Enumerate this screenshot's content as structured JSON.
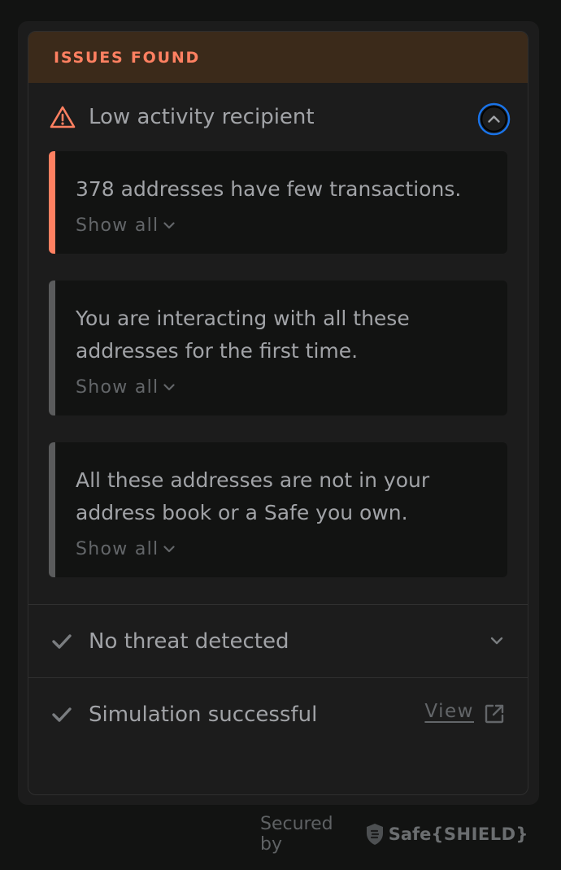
{
  "header": {
    "title": "ISSUES FOUND"
  },
  "issue": {
    "title": "Low activity recipient",
    "icon": "warning-triangle-icon",
    "accent_color": "#ff8061"
  },
  "cards": [
    {
      "text": "378 addresses have few transactions.",
      "show_all": "Show all",
      "severity": "danger"
    },
    {
      "text": "You are interacting with all these addresses for the first time.",
      "show_all": "Show all",
      "severity": "neutral"
    },
    {
      "text": "All these addresses are not in your address book or a Safe you own.",
      "show_all": "Show all",
      "severity": "neutral"
    }
  ],
  "checks": [
    {
      "label": "No threat detected",
      "icon": "check-icon",
      "action_icon": "chevron-down-icon"
    },
    {
      "label": "Simulation successful",
      "icon": "check-icon",
      "link": "View",
      "link_icon": "external-link-icon"
    }
  ],
  "footer": {
    "prefix": "Secured by",
    "brand": "Safe",
    "brand_suffix": "{SHIELD}"
  },
  "colors": {
    "background": "#121312",
    "panel": "#1c1c1c",
    "header_bg": "#3b2a1a",
    "warning": "#ff8061",
    "focus_ring": "#1a73e8"
  }
}
